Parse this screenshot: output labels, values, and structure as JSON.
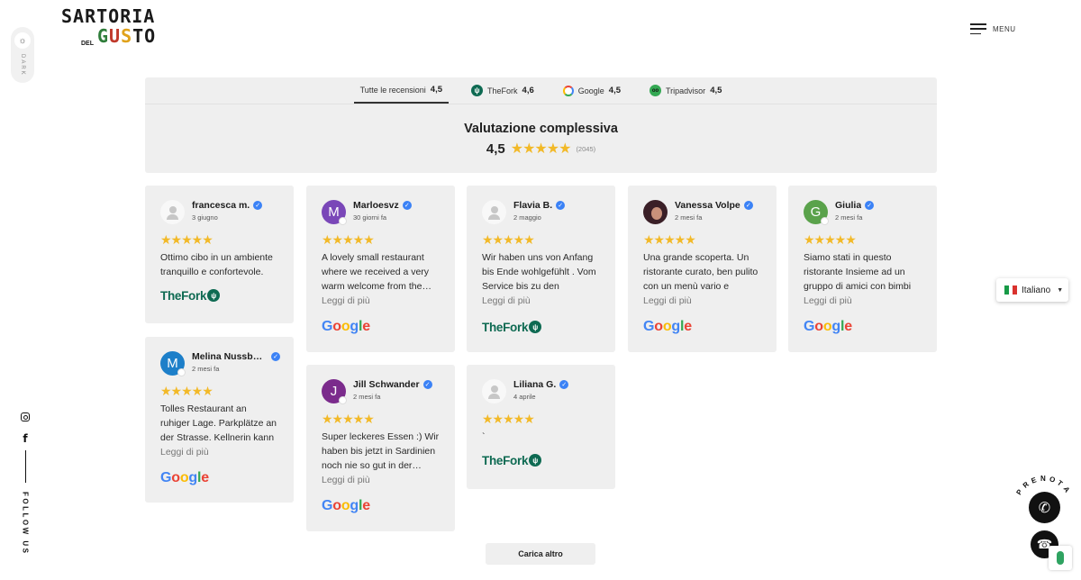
{
  "dark_toggle": {
    "label": "DARK"
  },
  "social": {
    "follow_label": "FOLLOW US"
  },
  "logo": {
    "line1": "SARTORIA",
    "del": "DEL",
    "line2": [
      "G",
      "U",
      "S",
      "TO"
    ]
  },
  "menu": {
    "label": "MENU"
  },
  "tabs": [
    {
      "label": "Tutte le recensioni",
      "score": "4,5",
      "icon": "all"
    },
    {
      "label": "TheFork",
      "score": "4,6",
      "icon": "thefork-icon"
    },
    {
      "label": "Google",
      "score": "4,5",
      "icon": "google-icon"
    },
    {
      "label": "Tripadvisor",
      "score": "4,5",
      "icon": "tripadvisor-icon"
    }
  ],
  "overall": {
    "title": "Valutazione complessiva",
    "score": "4,5",
    "count": "(2045)",
    "rating": 4.5
  },
  "reviews": [
    {
      "name": "francesca m.",
      "date": "3 giugno",
      "text": "Ottimo cibo in un ambiente tranquillo e confortevole.",
      "readmore": "",
      "source": "TheFork",
      "avatar": "default",
      "rating": 5
    },
    {
      "name": "Marloesvz",
      "date": "30 giorni fa",
      "text": "A lovely small restaurant where we received a very warm welcome from the…",
      "readmore": "Leggi di più",
      "source": "Google",
      "avatar": "M",
      "rating": 5
    },
    {
      "name": "Flavia B.",
      "date": "2 maggio",
      "text": "Wir haben uns von Anfang bis Ende wohlgefühlt . Vom Service bis zu den leckeren…",
      "readmore": "Leggi di più",
      "source": "TheFork",
      "avatar": "default",
      "rating": 5
    },
    {
      "name": "Vanessa Volpe",
      "date": "2 mesi fa",
      "text": "Una grande scoperta. Un ristorante curato, ben pulito con un menù vario e prezzi…",
      "readmore": "Leggi di più",
      "source": "Google",
      "avatar": "photo",
      "rating": 5
    },
    {
      "name": "Giulia",
      "date": "2 mesi fa",
      "text": "Siamo stati in questo ristorante Insieme ad un gruppo di amici con bimbi …",
      "readmore": "Leggi di più",
      "source": "Google",
      "avatar": "G",
      "rating": 5
    },
    {
      "name": "Melina Nussba…",
      "date": "2 mesi fa",
      "text": "Tolles Restaurant an ruhiger Lage. Parkplätze an der Strasse. Kellnerin kann leid…",
      "readmore": "Leggi di più",
      "source": "Google",
      "avatar": "M",
      "rating": 5
    },
    {
      "name": "Jill Schwander",
      "date": "2 mesi fa",
      "text": "Super leckeres Essen :) Wir haben bis jetzt in Sardinien noch nie so gut in der…",
      "readmore": "Leggi di più",
      "source": "Google",
      "avatar": "J",
      "rating": 5
    },
    {
      "name": "Liliana G.",
      "date": "4 aprile",
      "text": "`",
      "readmore": "",
      "source": "TheFork",
      "avatar": "default",
      "rating": 5
    }
  ],
  "sources": {
    "thefork": "TheFork",
    "google": [
      "G",
      "o",
      "o",
      "g",
      "l",
      "e"
    ]
  },
  "load_more": {
    "label": "Carica altro"
  },
  "language": {
    "label": "Italiano"
  },
  "prenota": {
    "label": "PRENOTA"
  },
  "colors": {
    "star": "#f2b928",
    "thefork": "#0e6a52",
    "verified": "#3b82f6",
    "avatar_marloesvz": "#7a47b8",
    "avatar_giulia": "#5aa24b",
    "avatar_melina": "#1d7fc9",
    "avatar_jill": "#7b2b8c"
  }
}
